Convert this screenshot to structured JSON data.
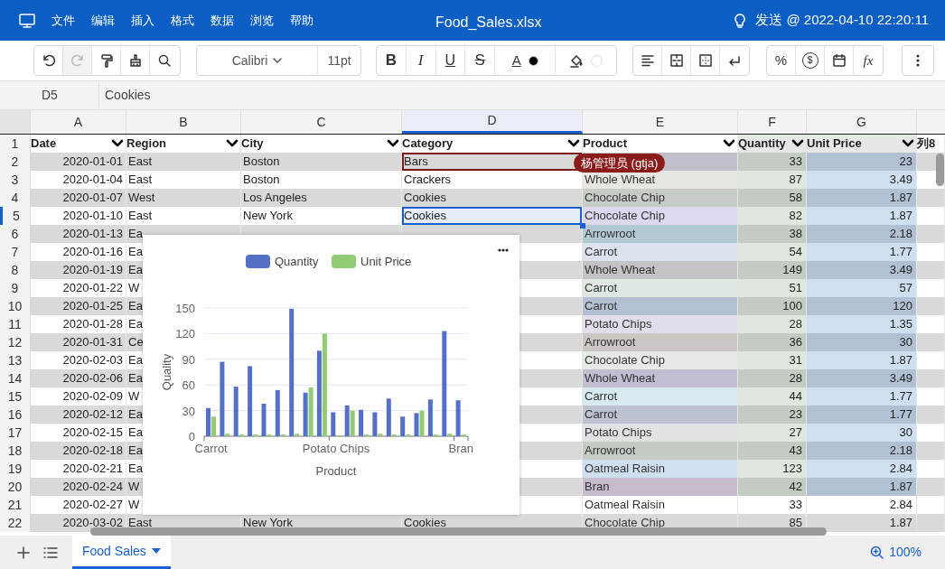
{
  "app": {
    "menu": [
      "文件",
      "编辑",
      "插入",
      "格式",
      "数据",
      "浏览",
      "帮助"
    ],
    "title": "Food_Sales.xlsx",
    "send_status": "发送 @ 2022-04-10 22:20:11"
  },
  "toolbar": {
    "redo": {
      "disabled": true
    },
    "font": "Calibri",
    "font_size": "11pt",
    "bold": "B",
    "italic": "I",
    "underline": "U",
    "strikethrough": "S",
    "font_color": {
      "label": "A",
      "color": "#000000"
    },
    "fill_color": {
      "color": "#ffffff"
    },
    "percent": "%",
    "currency": "$",
    "function": "fx"
  },
  "formula_bar": {
    "cell": "D5",
    "value": "Cookies"
  },
  "sheet": {
    "columns": [
      {
        "letter": "A",
        "selected": false
      },
      {
        "letter": "B",
        "selected": false
      },
      {
        "letter": "C",
        "selected": false
      },
      {
        "letter": "D",
        "selected": true
      },
      {
        "letter": "E",
        "selected": false
      },
      {
        "letter": "F",
        "selected": false
      },
      {
        "letter": "G",
        "selected": false
      }
    ],
    "header_row": {
      "num": "1",
      "labels": [
        "Date",
        "Region",
        "City",
        "Category",
        "Product",
        "Quantity",
        "Unit Price",
        "列8"
      ]
    },
    "rows": [
      {
        "num": "2",
        "date": "2020-01-01",
        "region": "East",
        "city": "Boston",
        "category": "Bars",
        "highlighted": true,
        "quantity": "33",
        "unit_price": "23",
        "selected": false,
        "collaborator": "杨管理员 (gtja)"
      },
      {
        "num": "3",
        "date": "2020-01-04",
        "region": "East",
        "city": "Boston",
        "category": "Crackers",
        "product": "Whole Wheat",
        "highlighted": true,
        "quantity": "87",
        "unit_price": "3.49",
        "selected": false
      },
      {
        "num": "4",
        "date": "2020-01-07",
        "region": "West",
        "city": "Los Angeles",
        "category": "Cookies",
        "product": "Chocolate Chip",
        "highlighted": true,
        "quantity": "58",
        "unit_price": "1.87",
        "selected": false
      },
      {
        "num": "5",
        "date": "2020-01-10",
        "region": "East",
        "city": "New York",
        "category": "Cookies",
        "product": "Chocolate Chip",
        "highlighted": true,
        "quantity": "82",
        "unit_price": "1.87",
        "selected": true
      },
      {
        "num": "6",
        "date": "2020-01-13",
        "region": "Ea",
        "product": "Arrowroot",
        "highlighted": true,
        "quantity": "38",
        "unit_price": "2.18",
        "selected": false
      },
      {
        "num": "7",
        "date": "2020-01-16",
        "region": "Ea",
        "product": "Carrot",
        "highlighted": true,
        "quantity": "54",
        "unit_price": "1.77",
        "selected": false
      },
      {
        "num": "8",
        "date": "2020-01-19",
        "region": "Ea",
        "product": "Whole Wheat",
        "highlighted": true,
        "quantity": "149",
        "unit_price": "3.49",
        "selected": false
      },
      {
        "num": "9",
        "date": "2020-01-22",
        "region": "W",
        "product": "Carrot",
        "highlighted": true,
        "quantity": "51",
        "unit_price": "57",
        "selected": false
      },
      {
        "num": "10",
        "date": "2020-01-25",
        "region": "Ea",
        "product": "Carrot",
        "highlighted": true,
        "quantity": "100",
        "unit_price": "120",
        "selected": false
      },
      {
        "num": "11",
        "date": "2020-01-28",
        "region": "Ea",
        "product": "Potato Chips",
        "highlighted": true,
        "quantity": "28",
        "unit_price": "1.35",
        "selected": false
      },
      {
        "num": "12",
        "date": "2020-01-31",
        "region": "Ce",
        "product": "Arrowroot",
        "highlighted": true,
        "quantity": "36",
        "unit_price": "30",
        "selected": false
      },
      {
        "num": "13",
        "date": "2020-02-03",
        "region": "Ea",
        "product": "Chocolate Chip",
        "highlighted": true,
        "quantity": "31",
        "unit_price": "1.87",
        "selected": false
      },
      {
        "num": "14",
        "date": "2020-02-06",
        "region": "Ea",
        "product": "Whole Wheat",
        "highlighted": true,
        "quantity": "28",
        "unit_price": "3.49",
        "selected": false
      },
      {
        "num": "15",
        "date": "2020-02-09",
        "region": "W",
        "product": "Carrot",
        "highlighted": true,
        "quantity": "44",
        "unit_price": "1.77",
        "selected": false
      },
      {
        "num": "16",
        "date": "2020-02-12",
        "region": "Ea",
        "product": "Carrot",
        "highlighted": true,
        "quantity": "23",
        "unit_price": "1.77",
        "selected": false
      },
      {
        "num": "17",
        "date": "2020-02-15",
        "region": "Ea",
        "product": "Potato Chips",
        "highlighted": true,
        "quantity": "27",
        "unit_price": "30",
        "selected": false
      },
      {
        "num": "18",
        "date": "2020-02-18",
        "region": "Ea",
        "product": "Arrowroot",
        "highlighted": true,
        "quantity": "43",
        "unit_price": "2.18",
        "selected": false
      },
      {
        "num": "19",
        "date": "2020-02-21",
        "region": "Ea",
        "product": "Oatmeal Raisin",
        "highlighted": true,
        "quantity": "123",
        "unit_price": "2.84",
        "selected": false
      },
      {
        "num": "20",
        "date": "2020-02-24",
        "region": "W",
        "product": "Bran",
        "highlighted": true,
        "quantity": "42",
        "unit_price": "1.87",
        "selected": false
      },
      {
        "num": "21",
        "date": "2020-02-27",
        "region": "W",
        "product": "Oatmeal Raisin",
        "highlighted": false,
        "quantity": "33",
        "unit_price": "2.84",
        "selected": false
      },
      {
        "num": "22",
        "date": "2020-03-02",
        "region": "East",
        "city": "New York",
        "category": "Cookies",
        "product": "Chocolate Chip",
        "highlighted": false,
        "quantity": "85",
        "unit_price": "1.87",
        "selected": false
      }
    ]
  },
  "chart": {
    "chart_data": {
      "type": "bar",
      "xlabel": "Product",
      "ylabel": "Quality",
      "categories": [
        "Carrot",
        null,
        null,
        null,
        null,
        null,
        null,
        null,
        null,
        "Potato Chips",
        null,
        null,
        null,
        null,
        null,
        null,
        null,
        null,
        "Bran"
      ],
      "ylim": [
        0,
        150
      ],
      "yticks": [
        0,
        30,
        60,
        90,
        120,
        150
      ],
      "grid": true,
      "legend": true,
      "series": [
        {
          "name": "Quantity",
          "color": "#5470c6",
          "values": [
            33,
            87,
            58,
            82,
            38,
            54,
            149,
            51,
            100,
            28,
            36,
            31,
            28,
            44,
            23,
            27,
            43,
            123,
            42
          ]
        },
        {
          "name": "Unit Price",
          "color": "#91cc75",
          "values": [
            23,
            3,
            2,
            2,
            2,
            2,
            3,
            57,
            120,
            1,
            30,
            2,
            3,
            2,
            2,
            30,
            2,
            3,
            2
          ]
        }
      ]
    }
  },
  "sheet_tabs": [
    {
      "label": "Food Sales",
      "selected": true
    }
  ],
  "zoom": "100%"
}
